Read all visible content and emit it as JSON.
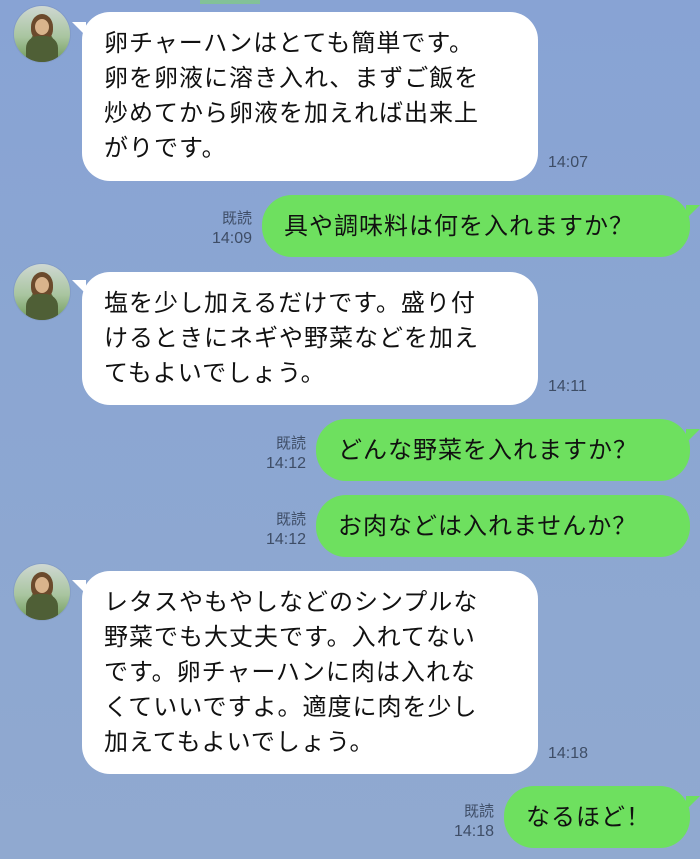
{
  "messages": [
    {
      "side": "in",
      "text": "卵チャーハンはとても簡単です。\n卵を卵液に溶き入れ、まずご飯を\n炒めてから卵液を加えれば出来上\nがりです。",
      "time": "14:07"
    },
    {
      "side": "out",
      "text": "具や調味料は何を入れますか？",
      "read": "既読",
      "time": "14:09"
    },
    {
      "side": "in",
      "text": "塩を少し加えるだけです。盛り付\nけるときにネギや野菜などを加え\nてもよいでしょう。",
      "time": "14:11"
    },
    {
      "side": "out",
      "text": "どんな野菜を入れますか？",
      "read": "既読",
      "time": "14:12"
    },
    {
      "side": "out",
      "text": "お肉などは入れませんか？",
      "read": "既読",
      "time": "14:12"
    },
    {
      "side": "in",
      "text": "レタスやもやしなどのシンプルな\n野菜でも大丈夫です。入れてない\nです。卵チャーハンに肉は入れな\nくていいですよ。適度に肉を少し\n加えてもよいでしょう。",
      "time": "14:18"
    },
    {
      "side": "out",
      "text": "なるほど！",
      "read": "既読",
      "time": "14:18"
    }
  ],
  "colors": {
    "background": "#8aa4d3",
    "incoming_bubble": "#ffffff",
    "outgoing_bubble": "#6ee05f",
    "meta_text": "#3e4d66"
  },
  "icons": {
    "avatar": "user-avatar-photo"
  }
}
